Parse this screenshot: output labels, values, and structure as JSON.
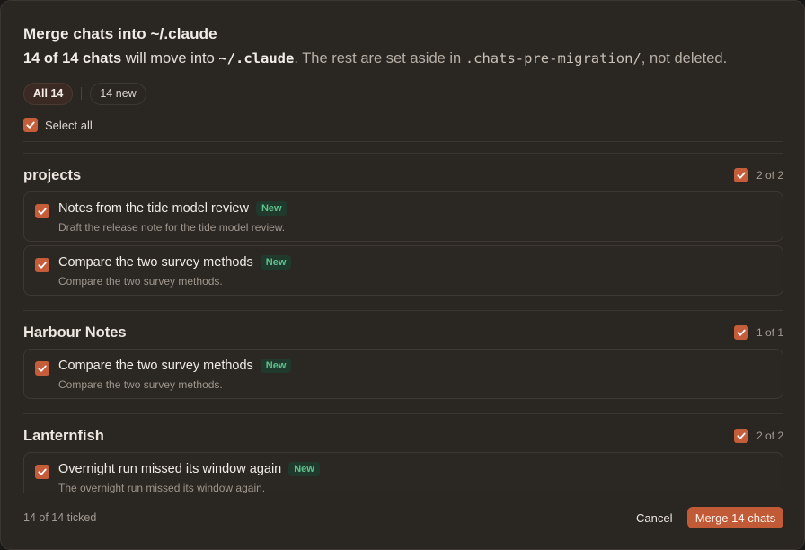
{
  "dialog": {
    "title": "Merge chats into ~/.claude",
    "summary": {
      "count": "14 of 14 chats",
      "will_move": " will move into ",
      "target": "~/.claude",
      "rest": ". The rest are set aside in ",
      "aside_dir": ".chats-pre-migration/",
      "tail": ", not deleted."
    },
    "filters": [
      {
        "label": "All 14",
        "active": true
      },
      {
        "label": "14 new",
        "active": false
      }
    ],
    "select_all_label": "Select all",
    "groups": [
      {
        "name": "projects",
        "count": "2 of 2",
        "items": [
          {
            "title": "Notes from the tide model review",
            "badge": "New",
            "desc": "Draft the release note for the tide model review."
          },
          {
            "title": "Compare the two survey methods",
            "badge": "New",
            "desc": "Compare the two survey methods."
          }
        ]
      },
      {
        "name": "Harbour Notes",
        "count": "1 of 1",
        "items": [
          {
            "title": "Compare the two survey methods",
            "badge": "New",
            "desc": "Compare the two survey methods."
          }
        ]
      },
      {
        "name": "Lanternfish",
        "count": "2 of 2",
        "items": [
          {
            "title": "Overnight run missed its window again",
            "badge": "New",
            "desc": "The overnight run missed its window again."
          }
        ]
      }
    ],
    "footer": {
      "ticked": "14 of 14 ticked",
      "cancel_label": "Cancel",
      "merge_label": "Merge 14 chats"
    }
  },
  "colors": {
    "accent": "#c55c3a",
    "badge_text": "#5fc28e",
    "background": "#2a2622"
  },
  "icons": {
    "checkbox": "checkmark-icon"
  }
}
